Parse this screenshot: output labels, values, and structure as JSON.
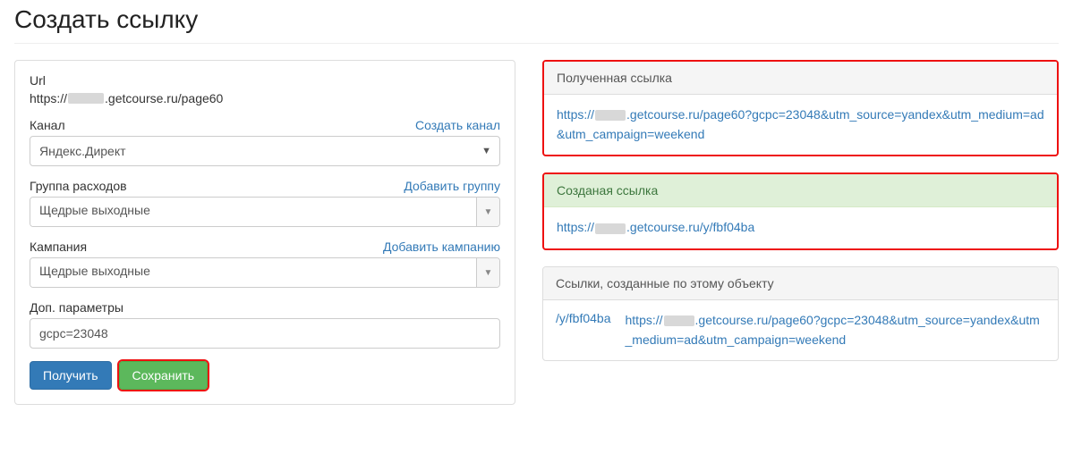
{
  "page": {
    "title": "Создать ссылку"
  },
  "form": {
    "url": {
      "label": "Url",
      "value_prefix": "https://",
      "value_suffix": ".getcourse.ru/page60"
    },
    "channel": {
      "label": "Канал",
      "create_link": "Создать канал",
      "value": "Яндекс.Директ"
    },
    "group": {
      "label": "Группа расходов",
      "add_link": "Добавить группу",
      "value": "Щедрые выходные"
    },
    "campaign": {
      "label": "Кампания",
      "add_link": "Добавить кампанию",
      "value": "Щедрые выходные"
    },
    "extra": {
      "label": "Доп. параметры",
      "value": "gcpc=23048"
    },
    "buttons": {
      "get": "Получить",
      "save": "Сохранить"
    }
  },
  "result": {
    "received": {
      "title": "Полученная ссылка",
      "prefix": "https://",
      "suffix": ".getcourse.ru/page60?gcpc=23048&utm_source=yandex&utm_medium=ad&utm_campaign=weekend"
    },
    "created": {
      "title": "Созданая ссылка",
      "prefix": "https://",
      "suffix": ".getcourse.ru/y/fbf04ba"
    },
    "object_links": {
      "title": "Ссылки, созданные по этому объекту",
      "items": [
        {
          "short": "/y/fbf04ba",
          "full_prefix": "https://",
          "full_suffix": ".getcourse.ru/page60?gcpc=23048&utm_source=yandex&utm_medium=ad&utm_campaign=weekend"
        }
      ]
    }
  }
}
